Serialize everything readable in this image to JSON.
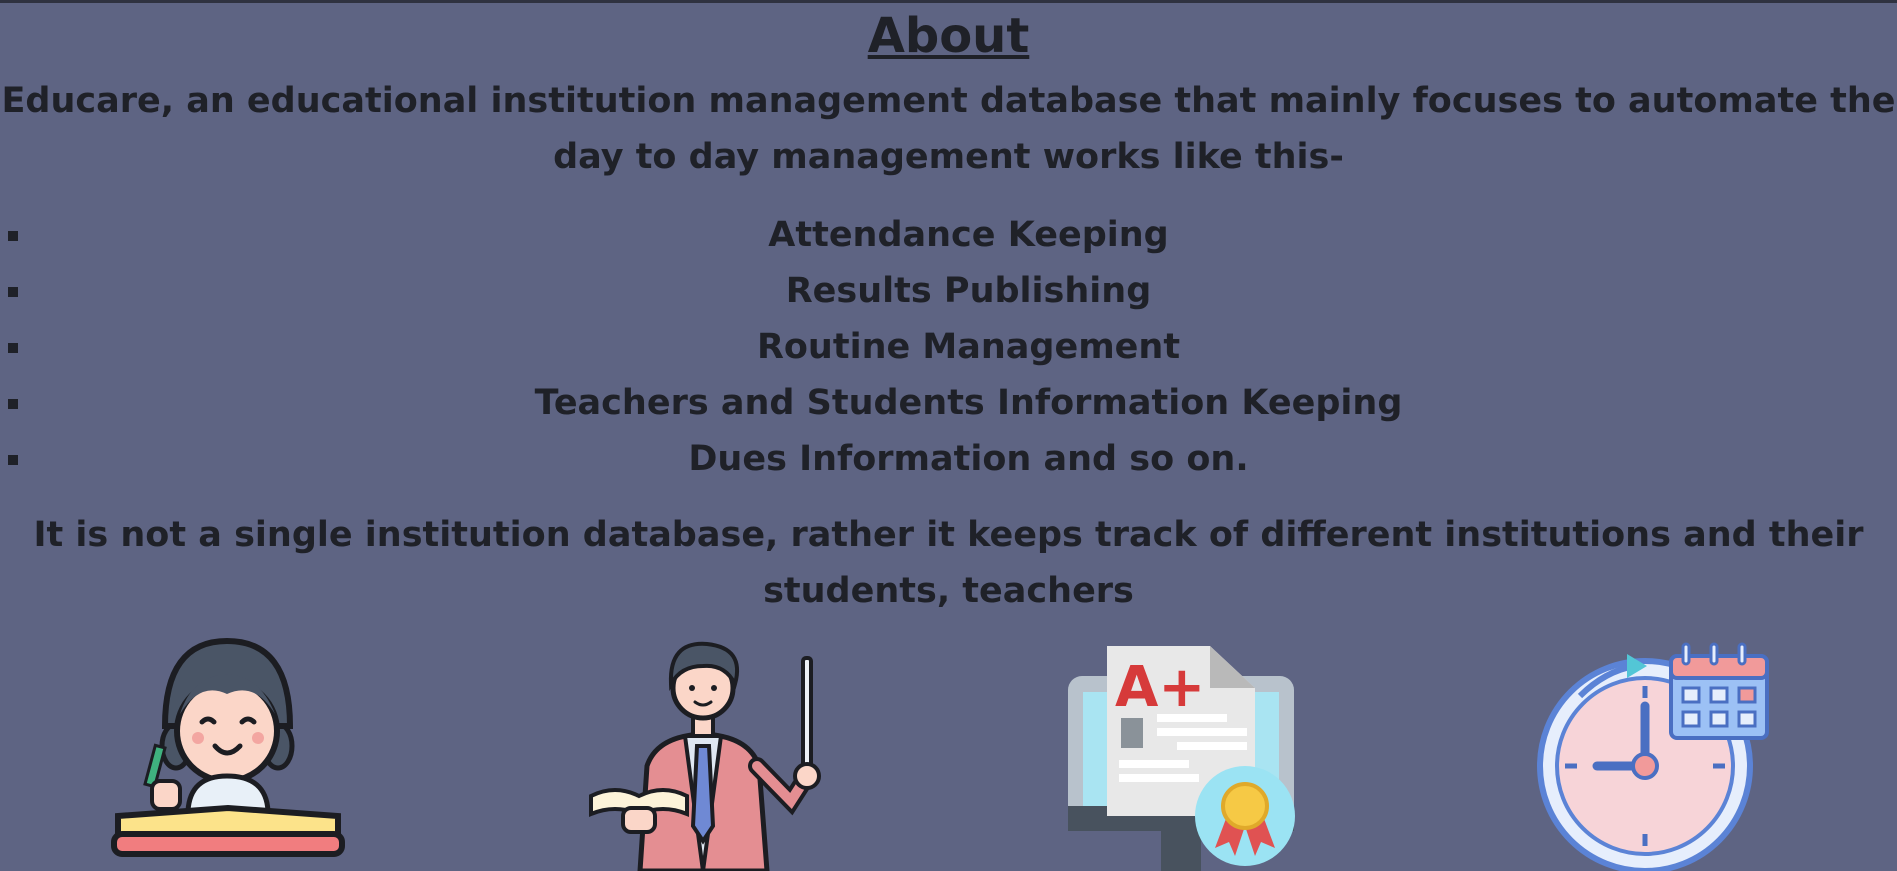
{
  "about": {
    "title": "About",
    "intro": "Educare, an educational institution management database that mainly focuses to automate the day to day management works like this-",
    "features": [
      "Attendance Keeping",
      "Results Publishing",
      "Routine Management",
      "Teachers and Students Information Keeping",
      "Dues Information and so on."
    ],
    "outro": "It is not a single institution database, rather it keeps track of different institutions and their students, teachers",
    "grade_text": "A+"
  },
  "illustrations": [
    {
      "icon": "student-writing-icon"
    },
    {
      "icon": "teacher-pointer-icon"
    },
    {
      "icon": "result-certificate-monitor-icon"
    },
    {
      "icon": "clock-calendar-icon"
    }
  ],
  "colors": {
    "background": "#5e6483",
    "text": "#1f2128"
  }
}
